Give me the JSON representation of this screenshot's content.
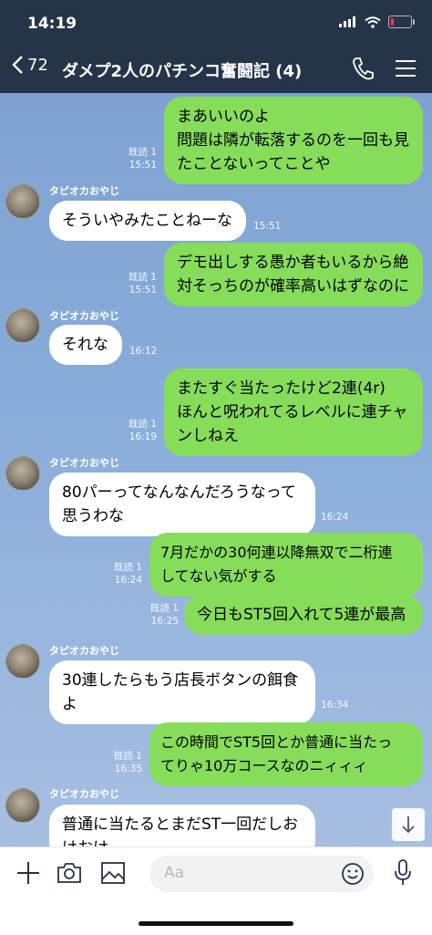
{
  "status": {
    "time": "14:19",
    "battery_level_pct": 15
  },
  "header": {
    "back_count": "72",
    "title": "ダメプ2人のパチンコ奮闘記 (4)"
  },
  "messages": [
    {
      "side": "me",
      "lines": [
        "まあいいのよ",
        "問題は隣が転落するのを一回も見",
        "たことないってことや"
      ],
      "read": "既読 1",
      "time": "15:51"
    },
    {
      "side": "other",
      "sender": "タピオカおやじ",
      "lines": [
        "そういやみたことねーな"
      ],
      "time": "15:51"
    },
    {
      "side": "me",
      "lines": [
        "デモ出しする愚か者もいるから絶",
        "対そっちのが確率高いはずなのに"
      ],
      "read": "既読 1",
      "time": "15:51"
    },
    {
      "side": "other",
      "sender": "タピオカおやじ",
      "lines": [
        "それな"
      ],
      "time": "16:12"
    },
    {
      "side": "me",
      "lines": [
        "またすぐ当たったけど2連(4r)",
        "ほんと呪われてるレベルに連チャ",
        "ンしねえ"
      ],
      "read": "既読 1",
      "time": "16:19"
    },
    {
      "side": "other",
      "sender": "タピオカおやじ",
      "lines": [
        "80パーってなんなんだろうなって",
        "思うわな"
      ],
      "time": "16:24"
    },
    {
      "side": "me",
      "lines": [
        "7月だかの30何連以降無双で二桁連",
        "してない気がする"
      ],
      "read": "既読 1",
      "time": "16:24"
    },
    {
      "side": "me",
      "lines": [
        "今日もST5回入れて5連が最高"
      ],
      "read": "既読 1",
      "time": "16:25"
    },
    {
      "side": "other",
      "sender": "タピオカおやじ",
      "lines": [
        "30連したらもう店長ボタンの餌食",
        "よ"
      ],
      "time": "16:34"
    },
    {
      "side": "me",
      "lines": [
        "この時間でST5回とか普通に当たっ",
        "てりゃ10万コースなのニィィィ"
      ],
      "read": "既読 1",
      "time": "16:35"
    },
    {
      "side": "other",
      "sender": "タピオカおやじ",
      "lines": [
        "普通に当たるとまだST一回だしお",
        "けおけ"
      ],
      "time": ""
    }
  ],
  "input": {
    "placeholder": "Aa"
  },
  "icons": {
    "back": "chevron-left-icon",
    "call": "phone-icon",
    "menu": "hamburger-icon",
    "add": "plus-icon",
    "camera": "camera-icon",
    "image": "image-icon",
    "emoji": "smiley-icon",
    "mic": "microphone-icon",
    "scroll": "arrow-down-icon"
  },
  "colors": {
    "header_bg": "#263449",
    "my_bubble": "#86dd5a",
    "their_bubble": "#ffffff",
    "chat_bg": "#88acd9"
  }
}
